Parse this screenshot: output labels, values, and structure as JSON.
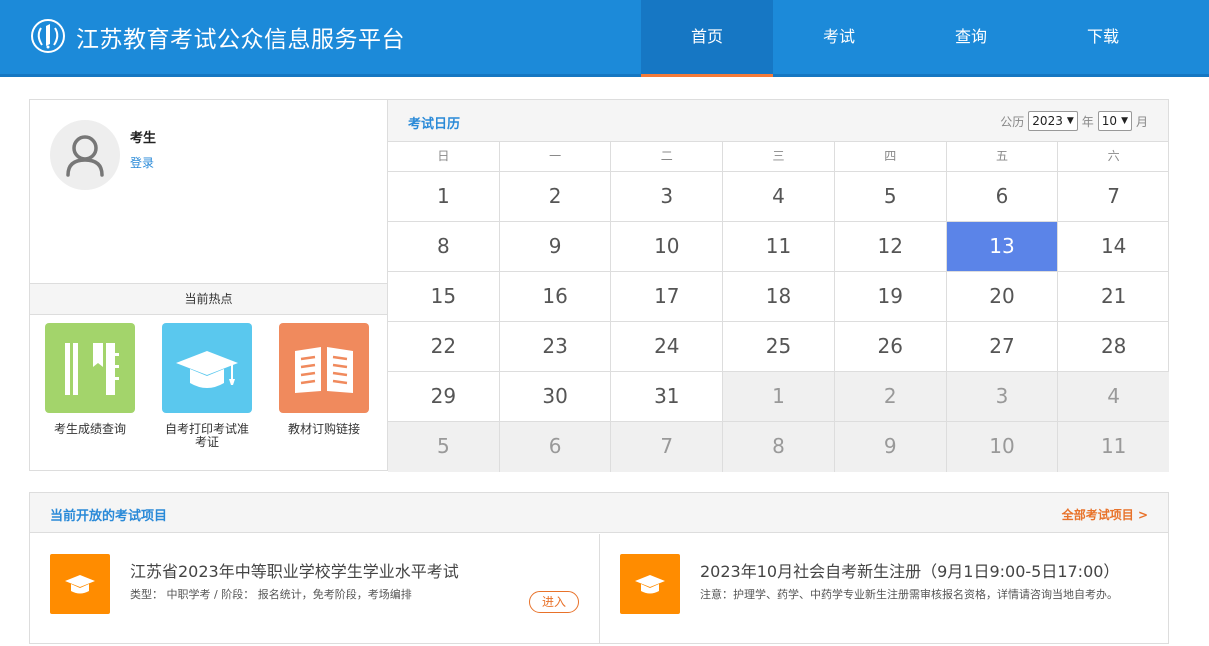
{
  "header": {
    "site_title": "江苏教育考试公众信息服务平台",
    "nav": [
      {
        "label": "首页",
        "active": true
      },
      {
        "label": "考试",
        "active": false
      },
      {
        "label": "查询",
        "active": false
      },
      {
        "label": "下载",
        "active": false
      }
    ]
  },
  "user": {
    "role": "考生",
    "login_label": "登录"
  },
  "hot": {
    "title": "当前热点",
    "items": [
      {
        "label": "考生成绩查询",
        "icon": "notebook-icon",
        "color": "#a3d46b"
      },
      {
        "label": "自考打印考试准考证",
        "icon": "graduation-cap-icon",
        "color": "#5ac8ee"
      },
      {
        "label": "教材订购链接",
        "icon": "open-book-icon",
        "color": "#f08a5d"
      }
    ]
  },
  "calendar": {
    "title": "考试日历",
    "era_label": "公历",
    "year": "2023",
    "year_unit": "年",
    "month": "10",
    "month_unit": "月",
    "weekdays": [
      "日",
      "一",
      "二",
      "三",
      "四",
      "五",
      "六"
    ],
    "today": "13",
    "rows": [
      [
        "1",
        "2",
        "3",
        "4",
        "5",
        "6",
        "7"
      ],
      [
        "8",
        "9",
        "10",
        "11",
        "12",
        "13",
        "14"
      ],
      [
        "15",
        "16",
        "17",
        "18",
        "19",
        "20",
        "21"
      ],
      [
        "22",
        "23",
        "24",
        "25",
        "26",
        "27",
        "28"
      ],
      [
        "29",
        "30",
        "31",
        "1",
        "2",
        "3",
        "4"
      ],
      [
        "5",
        "6",
        "7",
        "8",
        "9",
        "10",
        "11"
      ]
    ]
  },
  "exams": {
    "title": "当前开放的考试项目",
    "all_link": "全部考试项目 >",
    "items": [
      {
        "name": "江苏省2023年中等职业学校学生学业水平考试",
        "desc": "类型： 中职学考 / 阶段： 报名统计，免考阶段，考场编排",
        "button": "进入"
      },
      {
        "name": "2023年10月社会自考新生注册（9月1日9:00-5日17:00）",
        "desc": "注意：护理学、药学、中药学专业新生注册需审核报名资格，详情请咨询当地自考办。"
      }
    ]
  },
  "colors": {
    "header": "#1c8ad9",
    "accent": "#f47a38",
    "today": "#5b84e8",
    "exam_icon": "#ff8c00"
  }
}
